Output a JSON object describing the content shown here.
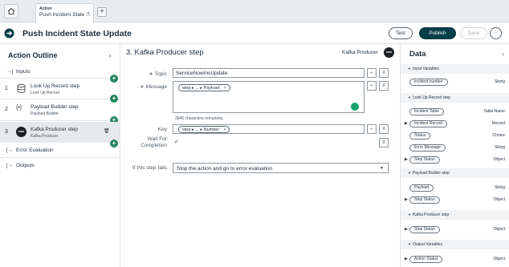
{
  "tabs": {
    "active_kicker": "Action",
    "active_title": "Push Incident State ...",
    "close_glyph": "×",
    "add_glyph": "+"
  },
  "header": {
    "title": "Push Incident State Update",
    "test_label": "Test",
    "publish_label": "Publish",
    "save_label": "Save",
    "more_label": "···"
  },
  "outline": {
    "title": "Action Outline",
    "collapse_glyph": "‹",
    "inputs_label": "Inputs",
    "steps": [
      {
        "num": "1",
        "name": "Look Up Record step",
        "sub": "Look Up Record",
        "icon": "database-icon"
      },
      {
        "num": "2",
        "name": "Payload Builder step",
        "sub": "Payload Builder",
        "icon": "code-braces-icon"
      },
      {
        "num": "3",
        "name": "Kafka Producer step",
        "sub": "Kafka Producer",
        "icon": "now-logo-icon"
      }
    ],
    "error_label": "Error Evaluation",
    "outputs_label": "Outputs"
  },
  "step_editor": {
    "title": "3.  Kafka Producer step",
    "badge_text": "Kafka Producer",
    "badge_logo": "now",
    "topic_label": "Topic",
    "topic_value": "ServiceNowIncUpdate",
    "message_label": "Message",
    "message_pill": "step ▸ ... ▸ Payload",
    "chars_remaining": "3946 characters remaining",
    "key_label": "Key",
    "key_pill": "step ▸ ... ▸ Number",
    "wait_label_1": "Wait For",
    "wait_label_2": "Completion",
    "wait_checked": "✓",
    "fail_label": "If this step fails",
    "fail_value": "Stop the action and go to error evaluation"
  },
  "data_panel": {
    "title": "Data",
    "chevron": "›",
    "sections": {
      "input_vars": "Input Variables",
      "lookup": "Look Up Record step",
      "payload": "Payload Builder step",
      "kafka": "Kafka Producer step",
      "outputs": "Output Variables"
    },
    "rows": {
      "incident_number": {
        "label": "incident number",
        "type": "String"
      },
      "incident_table": {
        "label": "Incident Table",
        "type": "Table Name"
      },
      "incident_record": {
        "label": "Incident Record",
        "type": "Record"
      },
      "status": {
        "label": "Status",
        "type": "Choice"
      },
      "error_message": {
        "label": "Error Message",
        "type": "String"
      },
      "lookup_step_status": {
        "label": "Step Status",
        "type": "Object"
      },
      "payload": {
        "label": "Payload",
        "type": "String"
      },
      "payload_step_status": {
        "label": "Step Status",
        "type": "Object"
      },
      "kafka_step_status": {
        "label": "Step Status",
        "type": "Object"
      },
      "action_status": {
        "label": "Action Status",
        "type": "Object"
      }
    }
  },
  "colors": {
    "publish": "#033e4a",
    "plus": "#27845f",
    "grammarly": "#13a26e"
  }
}
